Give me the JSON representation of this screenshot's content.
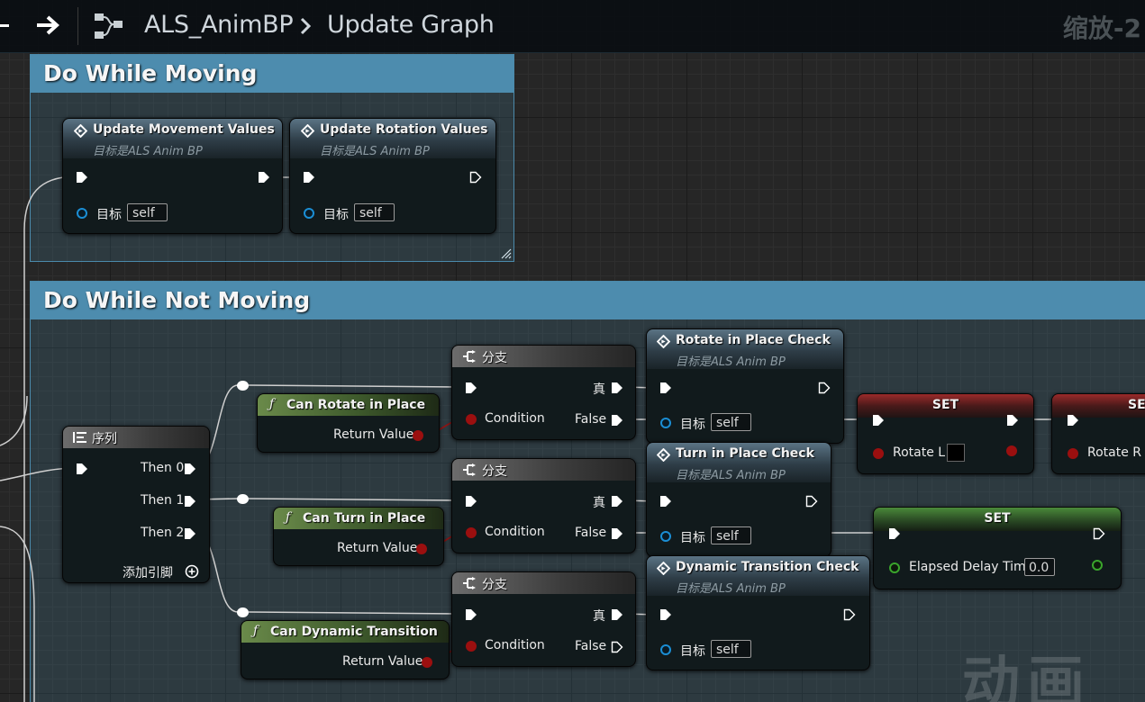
{
  "toolbar": {
    "graph_name": "ALS_AnimBP",
    "subgraph_name": "Update Graph",
    "zoom": "缩放-2"
  },
  "comments": {
    "moving_title": "Do While Moving",
    "not_moving_title": "Do While Not Moving"
  },
  "nodes": {
    "update_movement": {
      "title": "Update Movement Values",
      "subtitle": "目标是ALS Anim BP",
      "target_label": "目标",
      "target_value": "self"
    },
    "update_rotation": {
      "title": "Update Rotation Values",
      "subtitle": "目标是ALS Anim BP",
      "target_label": "目标",
      "target_value": "self"
    },
    "sequence": {
      "title": "序列",
      "then0": "Then 0",
      "then1": "Then 1",
      "then2": "Then 2",
      "add_pin": "添加引脚"
    },
    "can_rotate": {
      "title": "Can Rotate in Place",
      "output": "Return Value"
    },
    "can_turn": {
      "title": "Can Turn in Place",
      "output": "Return Value"
    },
    "can_dynamic": {
      "title": "Can Dynamic Transition",
      "output": "Return Value"
    },
    "branch1": {
      "title": "分支",
      "condition": "Condition",
      "true_label": "真",
      "false_label": "False"
    },
    "branch2": {
      "title": "分支",
      "condition": "Condition",
      "true_label": "真",
      "false_label": "False"
    },
    "branch3": {
      "title": "分支",
      "condition": "Condition",
      "true_label": "真",
      "false_label": "False"
    },
    "rotate_check": {
      "title": "Rotate in Place Check",
      "subtitle": "目标是ALS Anim BP",
      "target_label": "目标",
      "target_value": "self"
    },
    "turn_check": {
      "title": "Turn in Place Check",
      "subtitle": "目标是ALS Anim BP",
      "target_label": "目标",
      "target_value": "self"
    },
    "dynamic_check": {
      "title": "Dynamic Transition Check",
      "subtitle": "目标是ALS Anim BP",
      "target_label": "目标",
      "target_value": "self"
    },
    "set_rotate_l": {
      "title": "SET",
      "var": "Rotate L"
    },
    "set_rotate_r": {
      "title": "SET",
      "var": "Rotate R"
    },
    "set_elapsed": {
      "title": "SET",
      "var": "Elapsed Delay Time",
      "value": "0.0"
    }
  },
  "watermark": "动画",
  "colors": {
    "comment_header": "#4d8cae",
    "exec": "#ffffff",
    "object_pin": "#1b8ed4",
    "bool_pin": "#9b0f0f",
    "float_pin": "#3aa52c",
    "wire": "#d0d0d0",
    "bool_wire": "#8e1414"
  }
}
